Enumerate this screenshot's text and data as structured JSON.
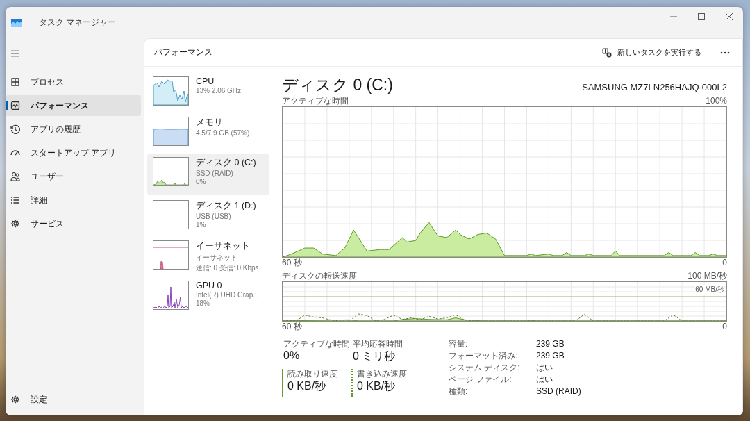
{
  "window": {
    "title": "タスク マネージャー"
  },
  "sidebar": {
    "items": [
      {
        "label": "プロセス",
        "selected": false
      },
      {
        "label": "パフォーマンス",
        "selected": true
      },
      {
        "label": "アプリの履歴",
        "selected": false
      },
      {
        "label": "スタートアップ アプリ",
        "selected": false
      },
      {
        "label": "ユーザー",
        "selected": false
      },
      {
        "label": "詳細",
        "selected": false
      },
      {
        "label": "サービス",
        "selected": false
      }
    ],
    "settings": "設定"
  },
  "header": {
    "title": "パフォーマンス",
    "action": "新しいタスクを実行する"
  },
  "devices": [
    {
      "kind": "cpu",
      "name": "CPU",
      "lines": [
        "13%  2.06 GHz"
      ],
      "selected": false
    },
    {
      "kind": "memory",
      "name": "メモリ",
      "lines": [
        "4.5/7.9 GB (57%)"
      ],
      "selected": false
    },
    {
      "kind": "disk",
      "name": "ディスク 0 (C:)",
      "lines": [
        "SSD (RAID)",
        "0%"
      ],
      "selected": true
    },
    {
      "kind": "idle",
      "name": "ディスク 1 (D:)",
      "lines": [
        "USB (USB)",
        "1%"
      ],
      "selected": false
    },
    {
      "kind": "ethernet",
      "name": "イーサネット",
      "lines": [
        "イーサネット",
        "送信: 0 受信: 0 Kbps"
      ],
      "selected": false
    },
    {
      "kind": "gpu",
      "name": "GPU 0",
      "lines": [
        "Intel(R) UHD Grap...",
        "18%"
      ],
      "selected": false
    }
  ],
  "detail": {
    "title": "ディスク 0 (C:)",
    "model": "SAMSUNG MZ7LN256HAJQ-000L2",
    "activity_chart": {
      "label": "アクティブな時間",
      "max": "100%",
      "x_start": "60 秒",
      "x_end": "0"
    },
    "transfer_chart": {
      "label": "ディスクの転送速度",
      "max": "100 MB/秒",
      "mid": "60 MB/秒",
      "x_start": "60 秒",
      "x_end": "0"
    },
    "stats": [
      {
        "kind": "plain",
        "label": "アクティブな時間",
        "value": "0%"
      },
      {
        "kind": "plain",
        "label": "平均応答時間",
        "value": "0 ミリ秒"
      },
      {
        "kind": "read",
        "label": "読み取り速度",
        "value": "0 KB/秒"
      },
      {
        "kind": "write",
        "label": "書き込み速度",
        "value": "0 KB/秒"
      }
    ],
    "properties": [
      {
        "label": "容量:",
        "value": "239 GB"
      },
      {
        "label": "フォーマット済み:",
        "value": "239 GB"
      },
      {
        "label": "システム ディスク:",
        "value": "はい"
      },
      {
        "label": "ページ ファイル:",
        "value": "はい"
      },
      {
        "label": "種類:",
        "value": "SSD (RAID)"
      }
    ]
  }
}
